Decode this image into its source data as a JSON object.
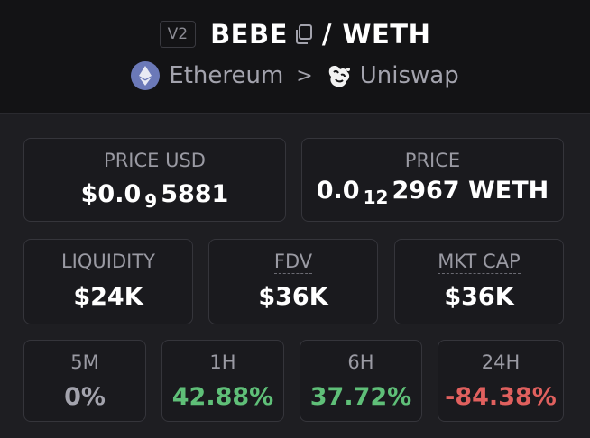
{
  "header": {
    "version": "V2",
    "base_token": "BEBE",
    "separator": "/",
    "quote_token": "WETH",
    "chain": "Ethereum",
    "breadcrumb_sep": ">",
    "dex": "Uniswap"
  },
  "price_usd": {
    "label": "PRICE USD",
    "prefix": "$0.0",
    "zeros": "9",
    "digits": "5881"
  },
  "price_native": {
    "label": "PRICE",
    "prefix": "0.0",
    "zeros": "12",
    "digits": "2967",
    "unit": "WETH"
  },
  "stats": [
    {
      "label": "LIQUIDITY",
      "value": "$24K"
    },
    {
      "label": "FDV",
      "value": "$36K"
    },
    {
      "label": "MKT CAP",
      "value": "$36K"
    }
  ],
  "changes": [
    {
      "label": "5M",
      "value": "0%",
      "trend": "neutral"
    },
    {
      "label": "1H",
      "value": "42.88%",
      "trend": "up"
    },
    {
      "label": "6H",
      "value": "37.72%",
      "trend": "up"
    },
    {
      "label": "24H",
      "value": "-84.38%",
      "trend": "down"
    }
  ],
  "colors": {
    "up": "#5fbf78",
    "down": "#e0605e",
    "neutral": "#a3a3ad",
    "background": "#1e1e22",
    "header_background": "#131315"
  },
  "icons": [
    "copy-icon",
    "ethereum-icon",
    "chevron-right-icon",
    "uniswap-icon"
  ]
}
